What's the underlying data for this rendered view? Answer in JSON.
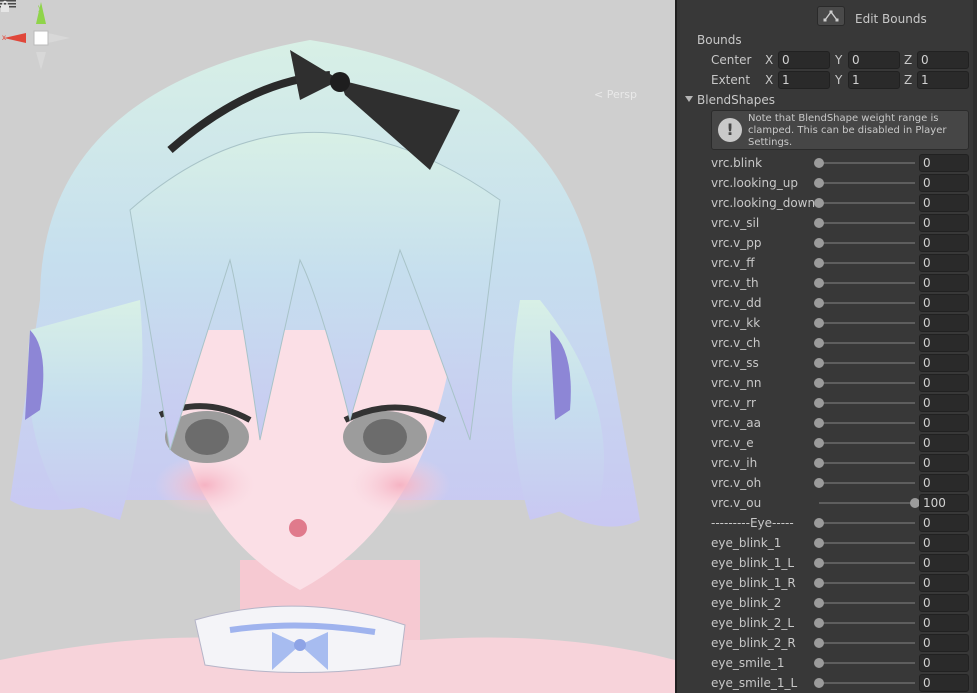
{
  "scene": {
    "persp_label": "< Persp",
    "gizmo_axes": [
      "y-axis",
      "x-axis",
      "z-axis"
    ]
  },
  "inspector": {
    "edit_bounds_label": "Edit Bounds",
    "bounds": {
      "title": "Bounds",
      "center_label": "Center",
      "extent_label": "Extent",
      "center": {
        "x": "0",
        "y": "0",
        "z": "0"
      },
      "extent": {
        "x": "1",
        "y": "1",
        "z": "1"
      },
      "axis_x": "X",
      "axis_y": "Y",
      "axis_z": "Z"
    },
    "blendshapes": {
      "title": "BlendShapes",
      "help": "Note that BlendShape weight range is clamped. This can be disabled in Player Settings.",
      "range_max": 100,
      "items": [
        {
          "label": "vrc.blink",
          "value": "0"
        },
        {
          "label": "vrc.looking_up",
          "value": "0"
        },
        {
          "label": "vrc.looking_down",
          "value": "0"
        },
        {
          "label": "vrc.v_sil",
          "value": "0"
        },
        {
          "label": "vrc.v_pp",
          "value": "0"
        },
        {
          "label": "vrc.v_ff",
          "value": "0"
        },
        {
          "label": "vrc.v_th",
          "value": "0"
        },
        {
          "label": "vrc.v_dd",
          "value": "0"
        },
        {
          "label": "vrc.v_kk",
          "value": "0"
        },
        {
          "label": "vrc.v_ch",
          "value": "0"
        },
        {
          "label": "vrc.v_ss",
          "value": "0"
        },
        {
          "label": "vrc.v_nn",
          "value": "0"
        },
        {
          "label": "vrc.v_rr",
          "value": "0"
        },
        {
          "label": "vrc.v_aa",
          "value": "0"
        },
        {
          "label": "vrc.v_e",
          "value": "0"
        },
        {
          "label": "vrc.v_ih",
          "value": "0"
        },
        {
          "label": "vrc.v_oh",
          "value": "0"
        },
        {
          "label": "vrc.v_ou",
          "value": "100"
        },
        {
          "label": "---------Eye-----",
          "value": "0"
        },
        {
          "label": "eye_blink_1",
          "value": "0"
        },
        {
          "label": "eye_blink_1_L",
          "value": "0"
        },
        {
          "label": "eye_blink_1_R",
          "value": "0"
        },
        {
          "label": "eye_blink_2",
          "value": "0"
        },
        {
          "label": "eye_blink_2_L",
          "value": "0"
        },
        {
          "label": "eye_blink_2_R",
          "value": "0"
        },
        {
          "label": "eye_smile_1",
          "value": "0"
        },
        {
          "label": "eye_smile_1_L",
          "value": "0"
        }
      ]
    }
  }
}
